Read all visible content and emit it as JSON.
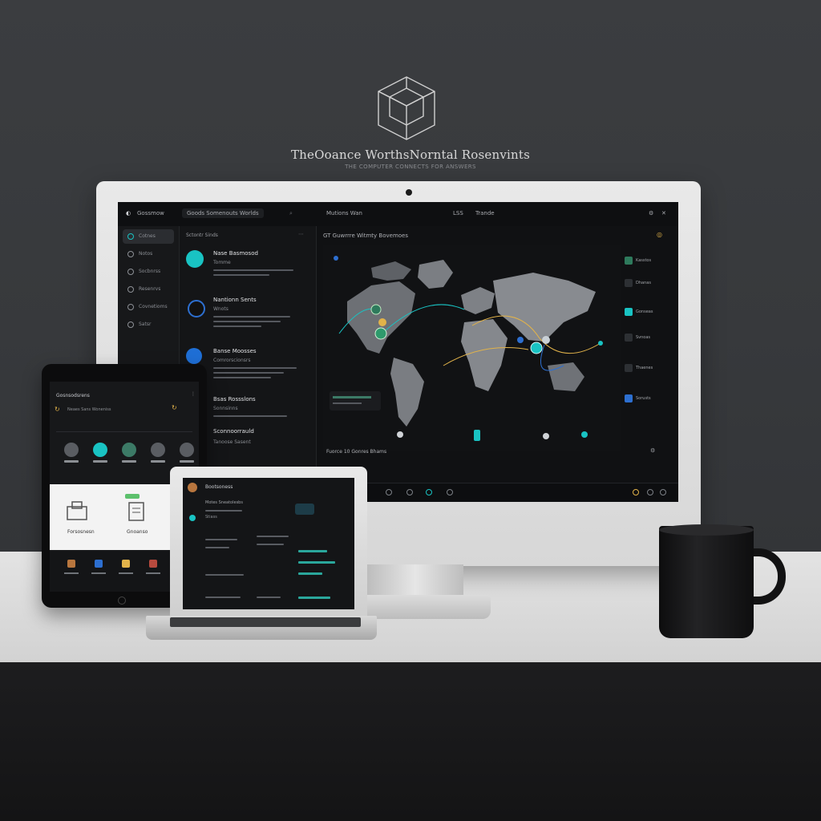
{
  "brand": {
    "title": "TheOoance WorthsNorntal Rosenvints",
    "subtitle": "THE COMPUTER CONNECTS FOR ANSWERS"
  },
  "desktop": {
    "topbar": {
      "app_name": "Gossmow",
      "search": "Goods Somenouts Worlds",
      "tab_a": "Mutions Wan",
      "tab_b": "LSS",
      "tab_c": "Trande"
    },
    "sidebar": {
      "items": [
        {
          "label": "Cotnes",
          "active": true
        },
        {
          "label": "Notos"
        },
        {
          "label": "Socbnrss"
        },
        {
          "label": "Resenrvs"
        },
        {
          "label": "Covnetioms"
        },
        {
          "label": "Satsr"
        }
      ]
    },
    "feed": {
      "header": "Sctontr Sinds",
      "items": [
        {
          "title": "Nase Basmosod",
          "subtitle": "Tomme",
          "color": "#19c3c3"
        },
        {
          "title": "Nantionn Sents",
          "subtitle": "Wnots",
          "color": "#2d6fd0"
        },
        {
          "title": "Banse Moosses",
          "subtitle": "Comrorscionsrs",
          "color": "#1f6fd6"
        },
        {
          "title": "Bsas Rossslons",
          "subtitle": "Sonnsinns",
          "color": "#2a2c30"
        },
        {
          "title": "Sconnoorrauld",
          "subtitle": "Tanoose Sasent",
          "color": "#e2b34a"
        }
      ]
    },
    "main": {
      "header": "GT Guwrrre Witmty Bovemoes",
      "map_footer": "Fuorce 10 Gonres Bhams",
      "stats": [
        "Kasstos",
        "Dhanas",
        "Gonseas",
        "Svnoas",
        "Thaenes",
        "Sorusts"
      ],
      "accent": "#19c3c3"
    }
  },
  "tablet": {
    "header": "Gosnsodsrens",
    "subtitle": "Neaes Sans Woneniss",
    "card_left": "Forsosnesn",
    "card_right": "Gnoanso"
  },
  "laptop": {
    "header": "Bootsoness",
    "line": "Motes Sneatolesbs",
    "sub": "Stiass"
  }
}
